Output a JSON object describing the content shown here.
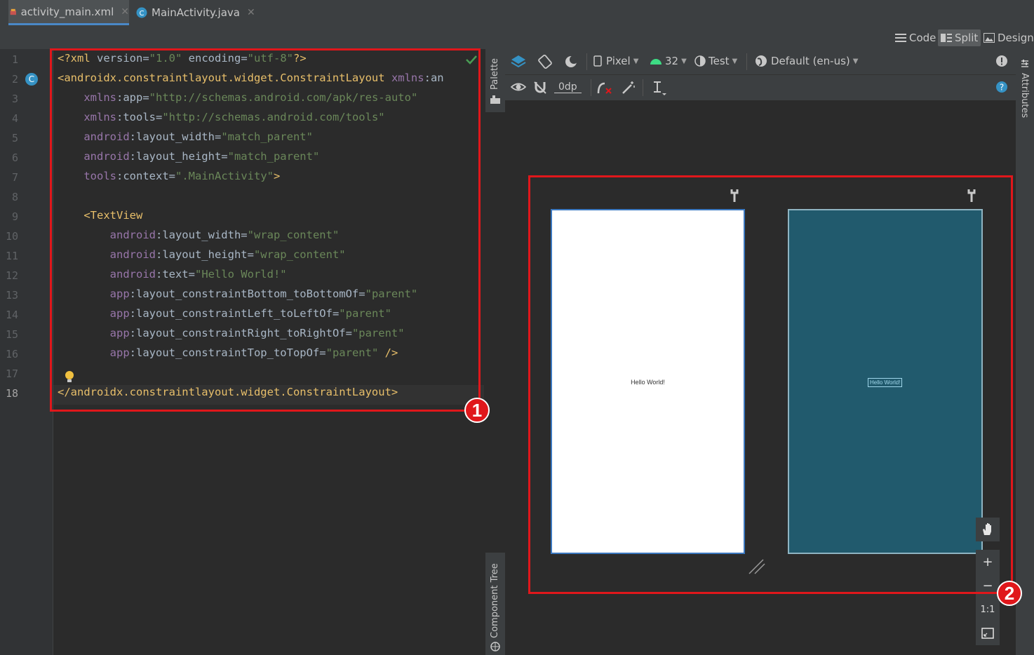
{
  "tabs": [
    {
      "label": "activity_main.xml",
      "icon": "xml-layout-icon",
      "active": true
    },
    {
      "label": "MainActivity.java",
      "icon": "java-class-icon",
      "active": false
    }
  ],
  "view_modes": {
    "code": "Code",
    "split": "Split",
    "design": "Design",
    "selected": "Split"
  },
  "editor": {
    "line_numbers": [
      "1",
      "2",
      "3",
      "4",
      "5",
      "6",
      "7",
      "8",
      "9",
      "10",
      "11",
      "12",
      "13",
      "14",
      "15",
      "16",
      "17",
      "18"
    ],
    "lines": [
      "<?xml version=\"1.0\" encoding=\"utf-8\"?>",
      "<androidx.constraintlayout.widget.ConstraintLayout xmlns:an",
      "    xmlns:app=\"http://schemas.android.com/apk/res-auto\"",
      "    xmlns:tools=\"http://schemas.android.com/tools\"",
      "    android:layout_width=\"match_parent\"",
      "    android:layout_height=\"match_parent\"",
      "    tools:context=\".MainActivity\">",
      "",
      "    <TextView",
      "        android:layout_width=\"wrap_content\"",
      "        android:layout_height=\"wrap_content\"",
      "        android:text=\"Hello World!\"",
      "        app:layout_constraintBottom_toBottomOf=\"parent\"",
      "        app:layout_constraintLeft_toLeftOf=\"parent\"",
      "        app:layout_constraintRight_toRightOf=\"parent\"",
      "        app:layout_constraintTop_toTopOf=\"parent\" />",
      "",
      "</androidx.constraintlayout.widget.ConstraintLayout>"
    ],
    "current_line": "18"
  },
  "side_panels": {
    "palette": "Palette",
    "component_tree": "Component Tree",
    "attributes": "Attributes"
  },
  "design_toolbar": {
    "device": "Pixel",
    "api_level": "32",
    "theme": "Test",
    "locale": "Default (en-us)",
    "margin": "0dp"
  },
  "preview": {
    "text": "Hello World!"
  },
  "zoom": {
    "zoom_in": "+",
    "zoom_out": "−",
    "actual_size": "1:1"
  },
  "annotations": {
    "badge1": "1",
    "badge2": "2"
  },
  "colors": {
    "annotation_red": "#e0171b",
    "blueprint": "#215a6d",
    "accent": "#4a88c7"
  }
}
